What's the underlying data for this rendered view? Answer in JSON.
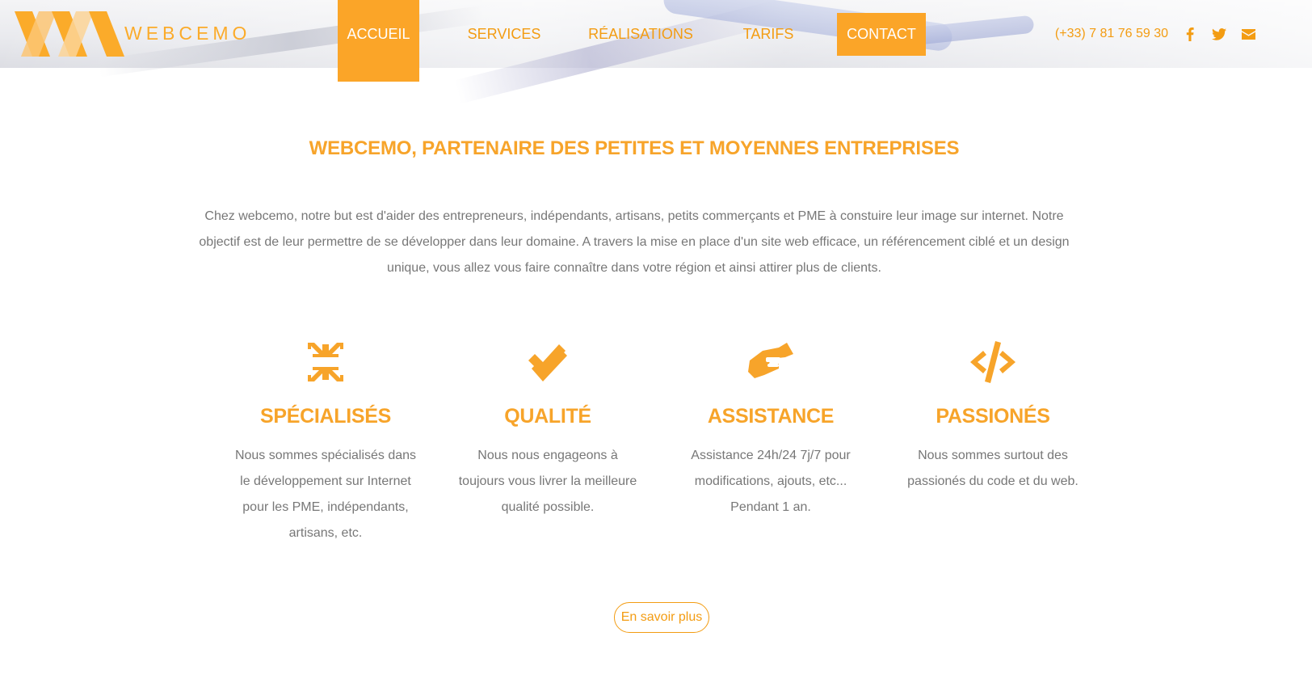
{
  "header": {
    "logo_text": "WEBCEMO",
    "nav": [
      {
        "label": "ACCUEIL"
      },
      {
        "label": "SERVICES"
      },
      {
        "label": "RÉALISATIONS"
      },
      {
        "label": "TARIFS"
      },
      {
        "label": "CONTACT"
      }
    ],
    "phone": "(+33) 7 81 76 59 30",
    "social_icons": [
      "facebook-icon",
      "twitter-icon",
      "envelope-icon"
    ]
  },
  "main": {
    "title": "WEBCEMO, PARTENAIRE DES PETITES ET MOYENNES ENTREPRISES",
    "intro": "Chez webcemo, notre but est d'aider des entrepreneurs, indépendants, artisans, petits commerçants et PME à constuire leur image sur internet. Notre objectif est de leur permettre de se développer dans leur domaine. A travers la mise en place d'un site web efficace, un référencement ciblé et un design unique, vous allez vous faire connaître dans votre région et ainsi attirer plus de clients.",
    "features": [
      {
        "icon": "compress-arrows-icon",
        "title": "SPÉCIALISÉS",
        "desc": "Nous sommes spécialisés dans le développement sur Internet pour les PME, indépendants, artisans, etc."
      },
      {
        "icon": "double-check-icon",
        "title": "QUALITÉ",
        "desc": "Nous nous engageons à toujours vous livrer la meilleure qualité possible."
      },
      {
        "icon": "handshake-icon",
        "title": "ASSISTANCE",
        "desc": "Assistance 24h/24 7j/7 pour modifications, ajouts, etc... Pendant 1 an."
      },
      {
        "icon": "code-icon",
        "title": "PASSIONÉS",
        "desc": "Nous sommes surtout des passionés du code et du web."
      }
    ],
    "more_button": "En savoir plus"
  },
  "colors": {
    "accent": "#fba528",
    "accent_text": "#f39c12",
    "body_text": "#777777"
  }
}
